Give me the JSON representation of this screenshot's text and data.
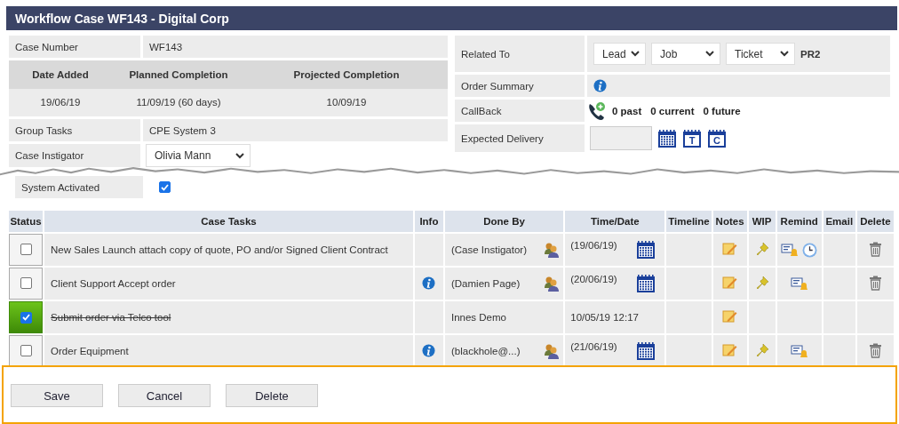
{
  "window": {
    "title": "Workflow Case WF143 - Digital Corp"
  },
  "case_number": {
    "label": "Case Number",
    "value": "WF143"
  },
  "dates": {
    "columns": [
      "Date Added",
      "Planned Completion",
      "Projected Completion"
    ],
    "values": [
      "19/06/19",
      "11/09/19 (60 days)",
      "10/09/19"
    ]
  },
  "group_tasks": {
    "label": "Group Tasks",
    "value": "CPE System 3"
  },
  "case_instigator": {
    "label": "Case Instigator",
    "value": "Olivia Mann"
  },
  "system_activated": {
    "label": "System Activated",
    "checked": true
  },
  "related_to": {
    "label": "Related To",
    "selects": [
      "Lead",
      "Job",
      "Ticket"
    ],
    "value": "PR2"
  },
  "order_summary": {
    "label": "Order Summary"
  },
  "callback": {
    "label": "CallBack",
    "counts": [
      "0 past",
      "0 current",
      "0 future"
    ]
  },
  "expected_delivery": {
    "label": "Expected Delivery",
    "calendar_letters": [
      "T",
      "C"
    ]
  },
  "tasks": {
    "columns": [
      "Status",
      "Case Tasks",
      "Info",
      "Done By",
      "Time/Date",
      "Timeline",
      "Notes",
      "WIP",
      "Remind",
      "Email",
      "Delete"
    ],
    "rows": [
      {
        "checked": false,
        "task": "New Sales Launch attach copy of quote, PO and/or Signed Client Contract",
        "info": false,
        "done_by": "(Case Instigator)",
        "assignable": true,
        "date": "(19/06/19)",
        "calendar": true,
        "notes": true,
        "wip": true,
        "remind": true,
        "clock": true,
        "delete": true
      },
      {
        "checked": false,
        "task": "Client Support Accept order",
        "info": true,
        "done_by": "(Damien Page)",
        "assignable": true,
        "date": "(20/06/19)",
        "calendar": true,
        "notes": true,
        "wip": true,
        "remind": true,
        "clock": false,
        "delete": true
      },
      {
        "checked": true,
        "task": "Submit order via Telco tool",
        "info": false,
        "done_by": "Innes Demo",
        "assignable": false,
        "date": "10/05/19 12:17",
        "calendar": false,
        "notes": true,
        "wip": false,
        "remind": false,
        "clock": false,
        "delete": false
      },
      {
        "checked": false,
        "task": "Order Equipment",
        "info": true,
        "done_by": "(blackhole@...)",
        "assignable": true,
        "date": "(21/06/19)",
        "calendar": true,
        "notes": true,
        "wip": true,
        "remind": true,
        "clock": false,
        "delete": true
      }
    ]
  },
  "buttons": [
    "Save",
    "Cancel",
    "Delete"
  ]
}
